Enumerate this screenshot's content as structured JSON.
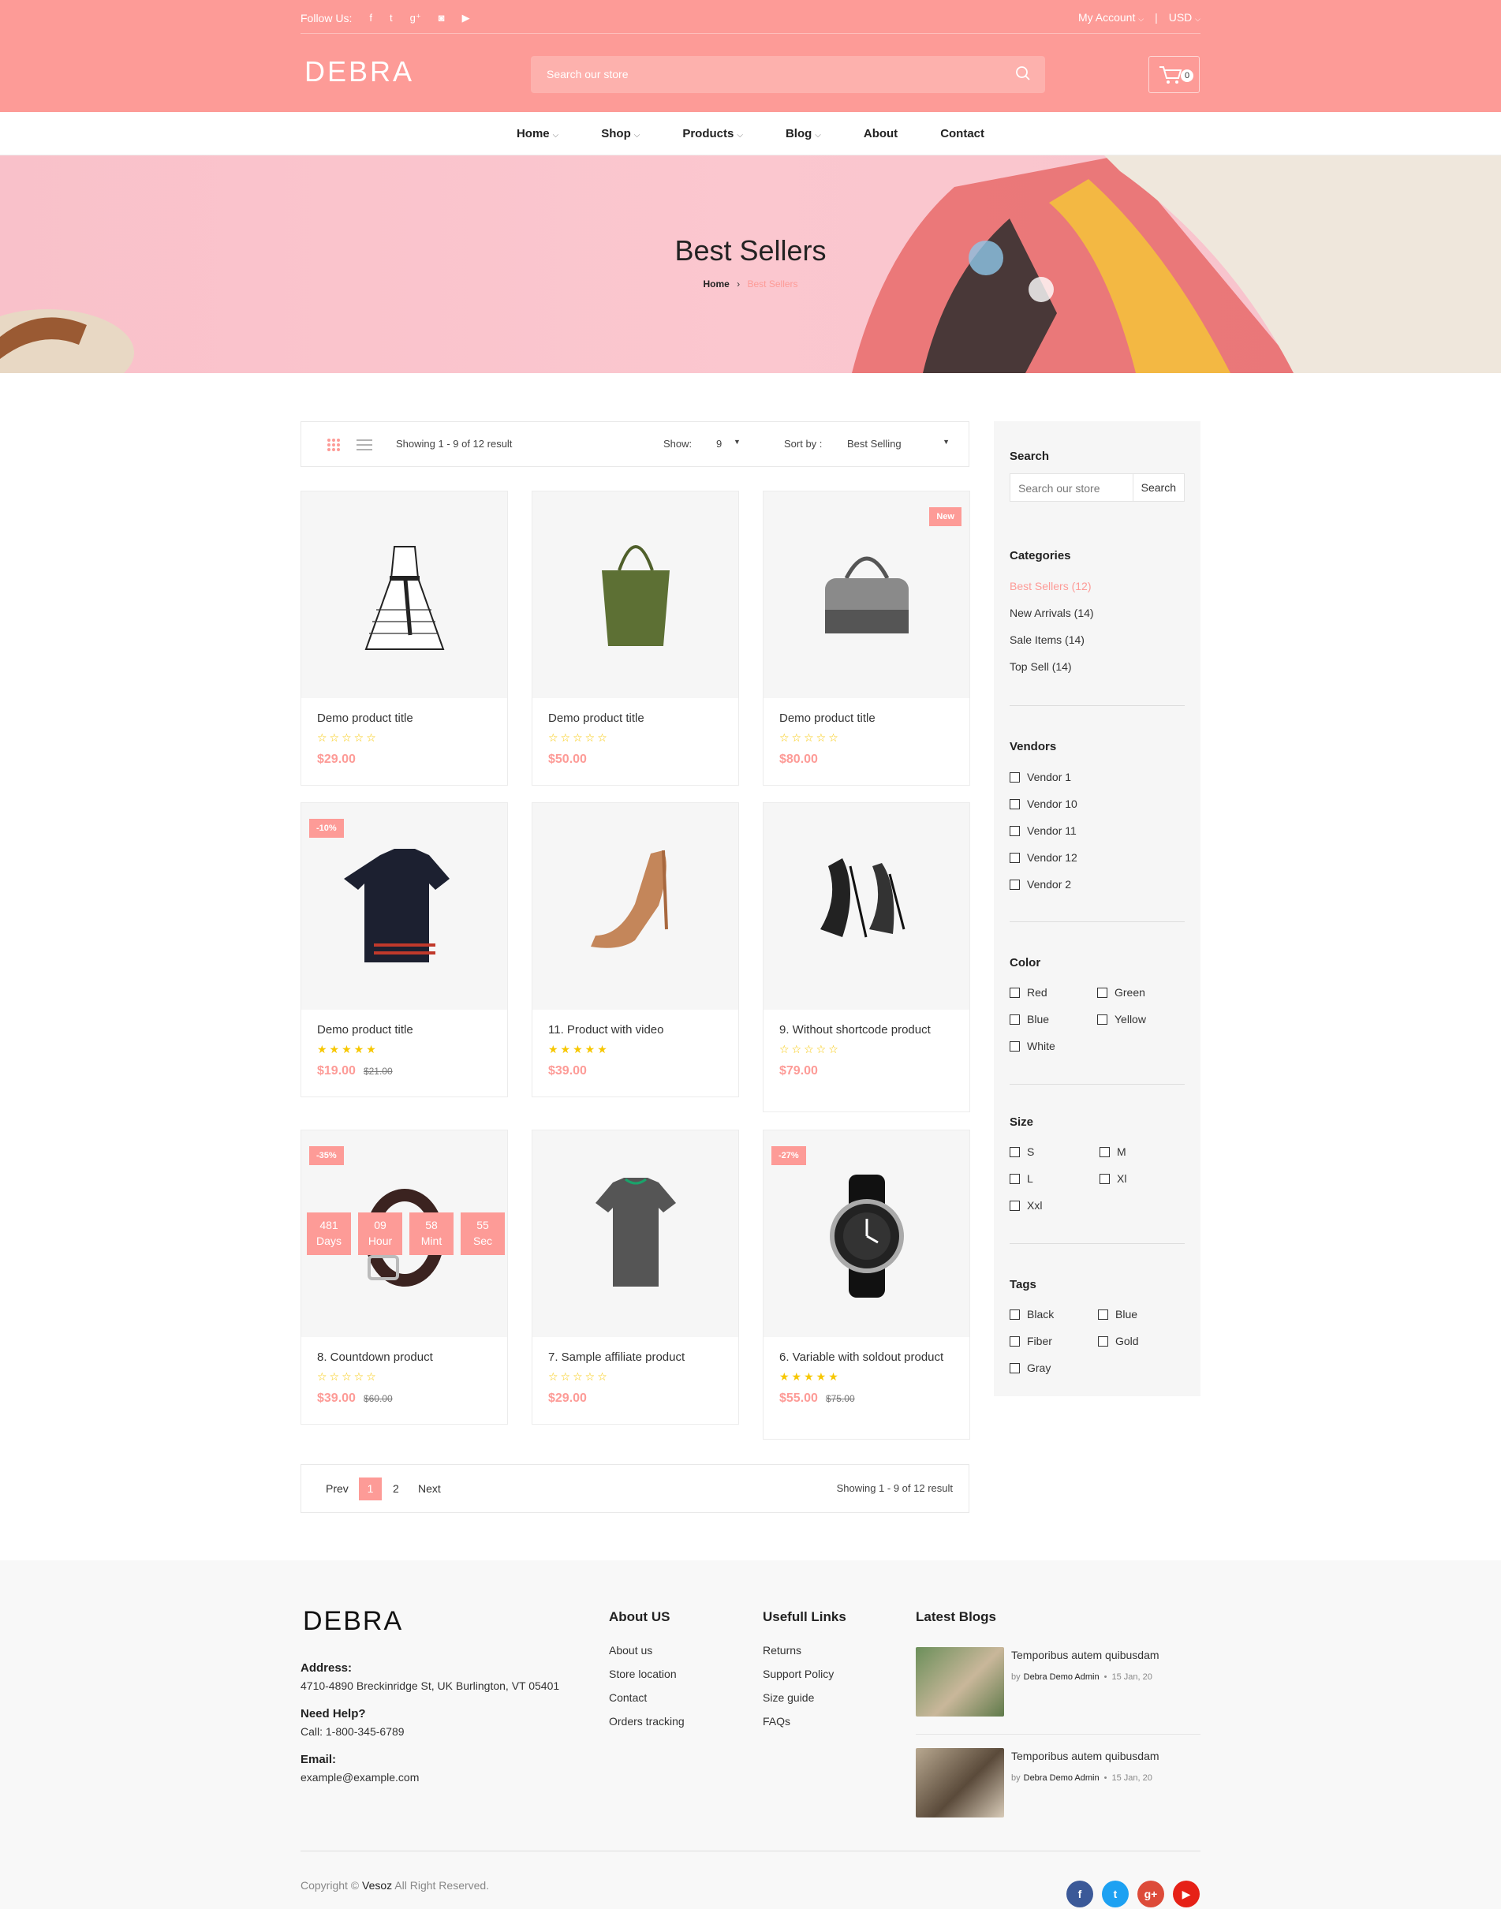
{
  "topbar": {
    "follow_label": "Follow Us:",
    "social_icons": [
      "facebook-icon",
      "twitter-icon",
      "google-plus-icon",
      "instagram-icon",
      "youtube-icon"
    ],
    "social_glyphs": [
      "f",
      "t",
      "g⁺",
      "◙",
      "▶"
    ],
    "account_label": "My Account",
    "currency_label": "USD"
  },
  "header": {
    "logo": "DEBRA",
    "search_placeholder": "Search our store",
    "cart_count": "0"
  },
  "nav": {
    "items": [
      {
        "label": "Home",
        "dropdown": true
      },
      {
        "label": "Shop",
        "dropdown": true
      },
      {
        "label": "Products",
        "dropdown": true
      },
      {
        "label": "Blog",
        "dropdown": true
      },
      {
        "label": "About",
        "dropdown": false
      },
      {
        "label": "Contact",
        "dropdown": false
      }
    ]
  },
  "banner": {
    "title": "Best Sellers",
    "breadcrumb_home": "Home",
    "breadcrumb_sep": "›",
    "breadcrumb_current": "Best Sellers"
  },
  "toolbar": {
    "showing": "Showing 1 - 9 of 12 result",
    "show_label": "Show:",
    "show_value": "9",
    "sort_label": "Sort by :",
    "sort_value": "Best Selling"
  },
  "products": [
    {
      "title": "Demo product title",
      "price": "$29.00",
      "old_price": "",
      "rating": 0,
      "badge": "",
      "image": "dress-icon"
    },
    {
      "title": "Demo product title",
      "price": "$50.00",
      "old_price": "",
      "rating": 0,
      "badge": "",
      "image": "tote-bag-icon"
    },
    {
      "title": "Demo product title",
      "price": "$80.00",
      "old_price": "",
      "rating": 0,
      "badge": "New",
      "image": "handbag-icon"
    },
    {
      "title": "Demo product title",
      "price": "$19.00",
      "old_price": "$21.00",
      "rating": 5,
      "badge": "-10%",
      "image": "shirt-icon"
    },
    {
      "title": "11. Product with video",
      "price": "$39.00",
      "old_price": "",
      "rating": 5,
      "badge": "",
      "image": "heel-shoe-icon"
    },
    {
      "title": "9. Without shortcode product",
      "price": "$79.00",
      "old_price": "",
      "rating": 0,
      "badge": "",
      "image": "heels-pair-icon"
    },
    {
      "title": "8. Countdown product",
      "price": "$39.00",
      "old_price": "$60.00",
      "rating": 0,
      "badge": "-35%",
      "image": "belt-icon"
    },
    {
      "title": "7. Sample affiliate product",
      "price": "$29.00",
      "old_price": "",
      "rating": 0,
      "badge": "",
      "image": "tshirt-icon"
    },
    {
      "title": "6. Variable with soldout product",
      "price": "$55.00",
      "old_price": "$75.00",
      "rating": 5,
      "badge": "-27%",
      "image": "watch-icon"
    }
  ],
  "countdown": [
    {
      "value": "481",
      "unit": "Days"
    },
    {
      "value": "09",
      "unit": "Hour"
    },
    {
      "value": "58",
      "unit": "Mint"
    },
    {
      "value": "55",
      "unit": "Sec"
    }
  ],
  "pagination": {
    "prev": "Prev",
    "pages": [
      "1",
      "2"
    ],
    "current": "1",
    "next": "Next",
    "showing": "Showing 1 - 9 of 12 result"
  },
  "sidebar": {
    "search_title": "Search",
    "search_placeholder": "Search our store",
    "search_button": "Search",
    "categories_title": "Categories",
    "categories": [
      "Best Sellers (12)",
      "New Arrivals (14)",
      "Sale Items (14)",
      "Top Sell (14)"
    ],
    "active_category": "Best Sellers (12)",
    "vendors_title": "Vendors",
    "vendors": [
      "Vendor 1",
      "Vendor 10",
      "Vendor 11",
      "Vendor 12",
      "Vendor 2"
    ],
    "color_title": "Color",
    "colors": [
      "Red",
      "Green",
      "Blue",
      "Yellow",
      "White"
    ],
    "size_title": "Size",
    "sizes": [
      "S",
      "M",
      "L",
      "Xl",
      "Xxl"
    ],
    "tags_title": "Tags",
    "tags": [
      "Black",
      "Blue",
      "Fiber",
      "Gold",
      "Gray"
    ]
  },
  "footer": {
    "logo": "DEBRA",
    "address_label": "Address:",
    "address": "4710-4890 Breckinridge St, UK Burlington, VT 05401",
    "help_label": "Need Help?",
    "help": "Call: 1-800-345-6789",
    "email_label": "Email:",
    "email": "example@example.com",
    "about_title": "About US",
    "about_links": [
      "About us",
      "Store location",
      "Contact",
      "Orders tracking"
    ],
    "useful_title": "Usefull Links",
    "useful_links": [
      "Returns",
      "Support Policy",
      "Size guide",
      "FAQs"
    ],
    "blogs_title": "Latest Blogs",
    "blogs": [
      {
        "title": "Temporibus autem quibusdam",
        "by": "by",
        "author": "Debra Demo Admin",
        "date": "15 Jan, 20"
      },
      {
        "title": "Temporibus autem quibusdam",
        "by": "by",
        "author": "Debra Demo Admin",
        "date": "15 Jan, 20"
      }
    ],
    "copyright_pre": "Copyright ©",
    "copyright_brand": "Vesoz",
    "copyright_post": "All Right Reserved.",
    "social": [
      {
        "icon": "facebook-icon",
        "glyph": "f",
        "color": "#3b5998"
      },
      {
        "icon": "twitter-icon",
        "glyph": "t",
        "color": "#1da1f2"
      },
      {
        "icon": "google-plus-icon",
        "glyph": "g+",
        "color": "#dd4b39"
      },
      {
        "icon": "youtube-icon",
        "glyph": "▶",
        "color": "#e62117"
      }
    ]
  },
  "colors": {
    "accent": "#fd9b97",
    "star": "#f7c700"
  }
}
